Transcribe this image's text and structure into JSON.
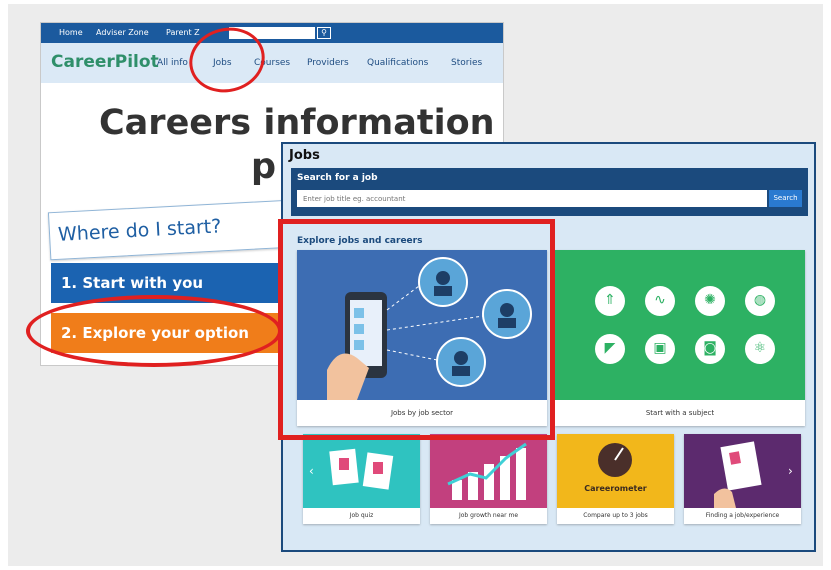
{
  "back_site": {
    "topbar": {
      "home": "Home",
      "adviser": "Adviser Zone",
      "parent": "Parent Z",
      "search_icon": "search-icon"
    },
    "logo": "CareerPilot",
    "nav": [
      "All info",
      "Jobs",
      "Courses",
      "Providers",
      "Qualifications",
      "Stories"
    ],
    "hero_line1": "Careers information a",
    "hero_line2": "p",
    "bubble": "Where do I start?",
    "step1": "1. Start with you",
    "step2": "2. Explore your option"
  },
  "jobs_page": {
    "title": "Jobs",
    "search_title": "Search for a job",
    "search_placeholder": "Enter job title eg. accountant",
    "search_button": "Search",
    "explore_label": "Explore jobs and careers",
    "card_sector": "Jobs by job sector",
    "card_subject": "Start with a subject",
    "small_cards": [
      "Job quiz",
      "Job growth near me",
      "Compare up to 3 jobs",
      "Finding a job/experience"
    ],
    "careerometer": "Careerometer",
    "arrows": {
      "prev": "‹",
      "next": "›"
    }
  },
  "colors": {
    "accent_red": "#e02020",
    "navy": "#1b4a7d",
    "green": "#2db163",
    "teal": "#2fc3c0",
    "pink": "#c2407e",
    "yellow": "#f2b71b",
    "purple": "#5c2a6e"
  }
}
